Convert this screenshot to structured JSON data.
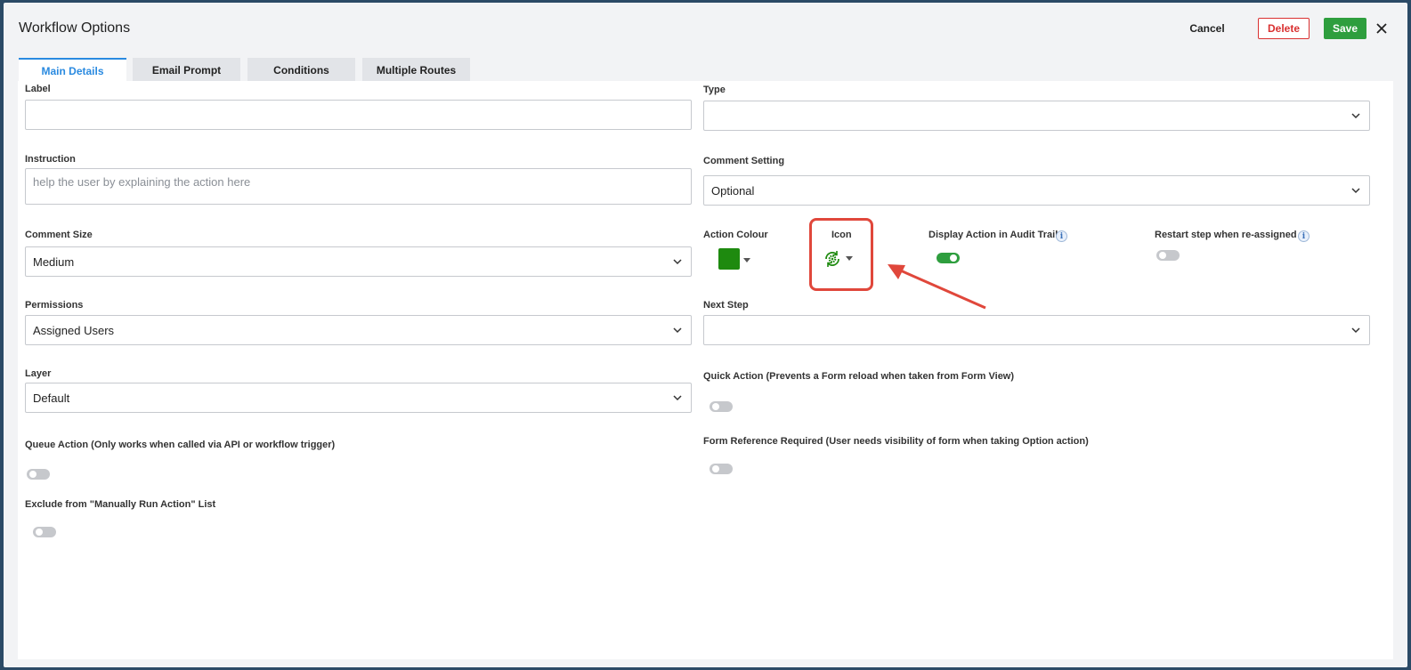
{
  "header": {
    "title": "Workflow Options",
    "cancel_label": "Cancel",
    "delete_label": "Delete",
    "save_label": "Save"
  },
  "tabs": [
    {
      "label": "Main Details",
      "active": true
    },
    {
      "label": "Email Prompt",
      "active": false
    },
    {
      "label": "Conditions",
      "active": false
    },
    {
      "label": "Multiple Routes",
      "active": false
    }
  ],
  "form": {
    "label": {
      "label": "Label",
      "value": ""
    },
    "type": {
      "label": "Type",
      "value": ""
    },
    "instruction": {
      "label": "Instruction",
      "placeholder": "help the user by explaining the action here",
      "value": ""
    },
    "comment_setting": {
      "label": "Comment Setting",
      "value": "Optional"
    },
    "comment_size": {
      "label": "Comment Size",
      "value": "Medium"
    },
    "action_colour": {
      "label": "Action Colour",
      "color": "#1e8a0f"
    },
    "icon": {
      "label": "Icon",
      "icon": "cog-refresh-icon",
      "color": "#1e8a0f"
    },
    "display_in_audit": {
      "label": "Display Action in Audit Trail",
      "on": true
    },
    "restart_step": {
      "label": "Restart step when re-assigned",
      "on": false
    },
    "permissions": {
      "label": "Permissions",
      "value": "Assigned Users"
    },
    "next_step": {
      "label": "Next Step",
      "value": ""
    },
    "layer": {
      "label": "Layer",
      "value": "Default"
    },
    "quick_action": {
      "label": "Quick Action (Prevents a Form reload when taken from Form View)",
      "on": false
    },
    "queue_action": {
      "label": "Queue Action (Only works when called via API or workflow trigger)",
      "on": false
    },
    "form_reference": {
      "label": "Form Reference Required (User needs visibility of form when taking Option action)",
      "on": false
    },
    "exclude_manual": {
      "label": "Exclude from \"Manually Run Action\" List",
      "on": false
    }
  },
  "colors": {
    "accent": "#2a8ae0",
    "save": "#2e9e3e",
    "delete": "#d93030",
    "annotation": "#e0473b"
  }
}
